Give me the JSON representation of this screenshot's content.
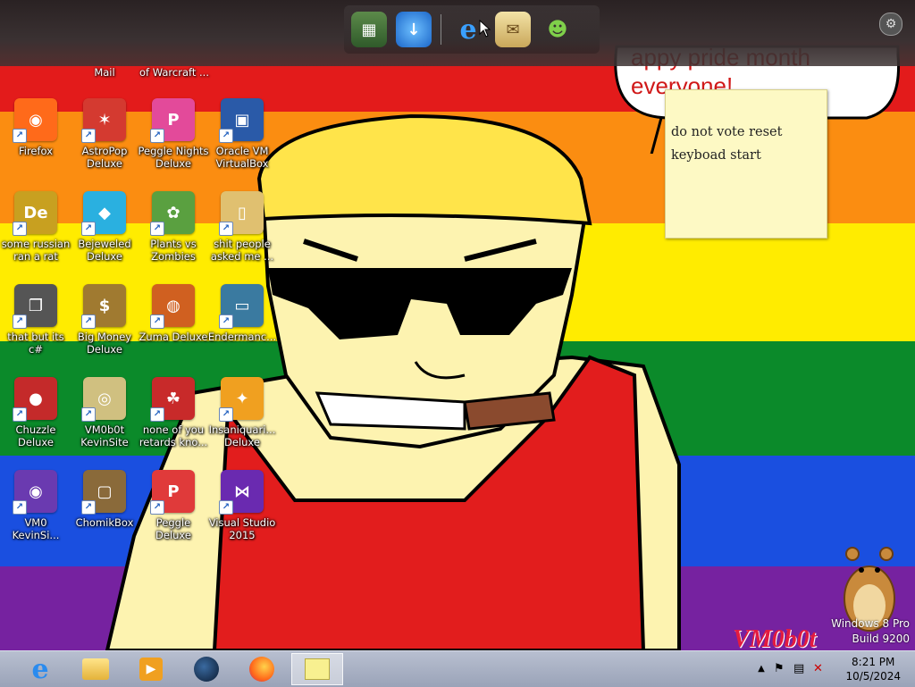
{
  "colors": {
    "red": "#e31b1b",
    "orange": "#fb8d11",
    "yellow": "#ffec00",
    "green": "#0b8a2a",
    "blue": "#1a4fe0",
    "purple": "#7622a0",
    "accent_red": "#d01818"
  },
  "top_row": {
    "labels": [
      "Mail",
      "of Warcraft ..."
    ]
  },
  "desktop_icons": [
    {
      "label": "Firefox",
      "icon": "firefox-icon"
    },
    {
      "label": "AstroPop Deluxe",
      "icon": "astropop-icon"
    },
    {
      "label": "Peggle Nights Deluxe",
      "icon": "peggle-nights-icon"
    },
    {
      "label": "Oracle VM VirtualBox",
      "icon": "virtualbox-icon"
    },
    {
      "label": "some russian ran a rat",
      "icon": "folder-de-icon"
    },
    {
      "label": "Bejeweled Deluxe",
      "icon": "bejeweled-icon"
    },
    {
      "label": "Plants vs Zombies",
      "icon": "plants-vs-zombies-icon"
    },
    {
      "label": "shit people asked me ...",
      "icon": "folder-icon"
    },
    {
      "label": "that but its c#",
      "icon": "window-stack-icon"
    },
    {
      "label": "Big Money Deluxe",
      "icon": "money-bag-icon"
    },
    {
      "label": "Zuma Deluxe",
      "icon": "zuma-icon"
    },
    {
      "label": "Endermanc...",
      "icon": "app-window-icon"
    },
    {
      "label": "Chuzzle Deluxe",
      "icon": "chuzzle-icon"
    },
    {
      "label": "VM0b0t KevinSite",
      "icon": "web-shortcut-icon"
    },
    {
      "label": "none of you retards kno...",
      "icon": "dragon-icon"
    },
    {
      "label": "Insaniquari... Deluxe",
      "icon": "insaniquarium-icon"
    },
    {
      "label": "VM0 KevinSi...",
      "icon": "firefox-file-icon"
    },
    {
      "label": "ChomikBox",
      "icon": "chomikbox-icon"
    },
    {
      "label": "Peggle Deluxe",
      "icon": "peggle-icon"
    },
    {
      "label": "Visual Studio 2015",
      "icon": "visual-studio-icon"
    }
  ],
  "speech_bubble": {
    "text": "appy pride month everyone!"
  },
  "sticky_note": {
    "text": "do not vote reset\nkeyboad start"
  },
  "watermark": {
    "edition": "Windows 8 Pro",
    "build": "Build 9200"
  },
  "logo": {
    "text": "VM0b0t"
  },
  "clock": {
    "time": "8:21 PM",
    "date": "10/5/2024"
  },
  "dock_icons": [
    "tiles-icon",
    "ie-download-icon",
    "internet-explorer-icon",
    "mail-icon",
    "messenger-icon"
  ],
  "taskbar_items": [
    "internet-explorer-icon",
    "file-explorer-icon",
    "media-player-icon",
    "globe-icon",
    "firefox-icon",
    "sticky-notes-icon"
  ]
}
